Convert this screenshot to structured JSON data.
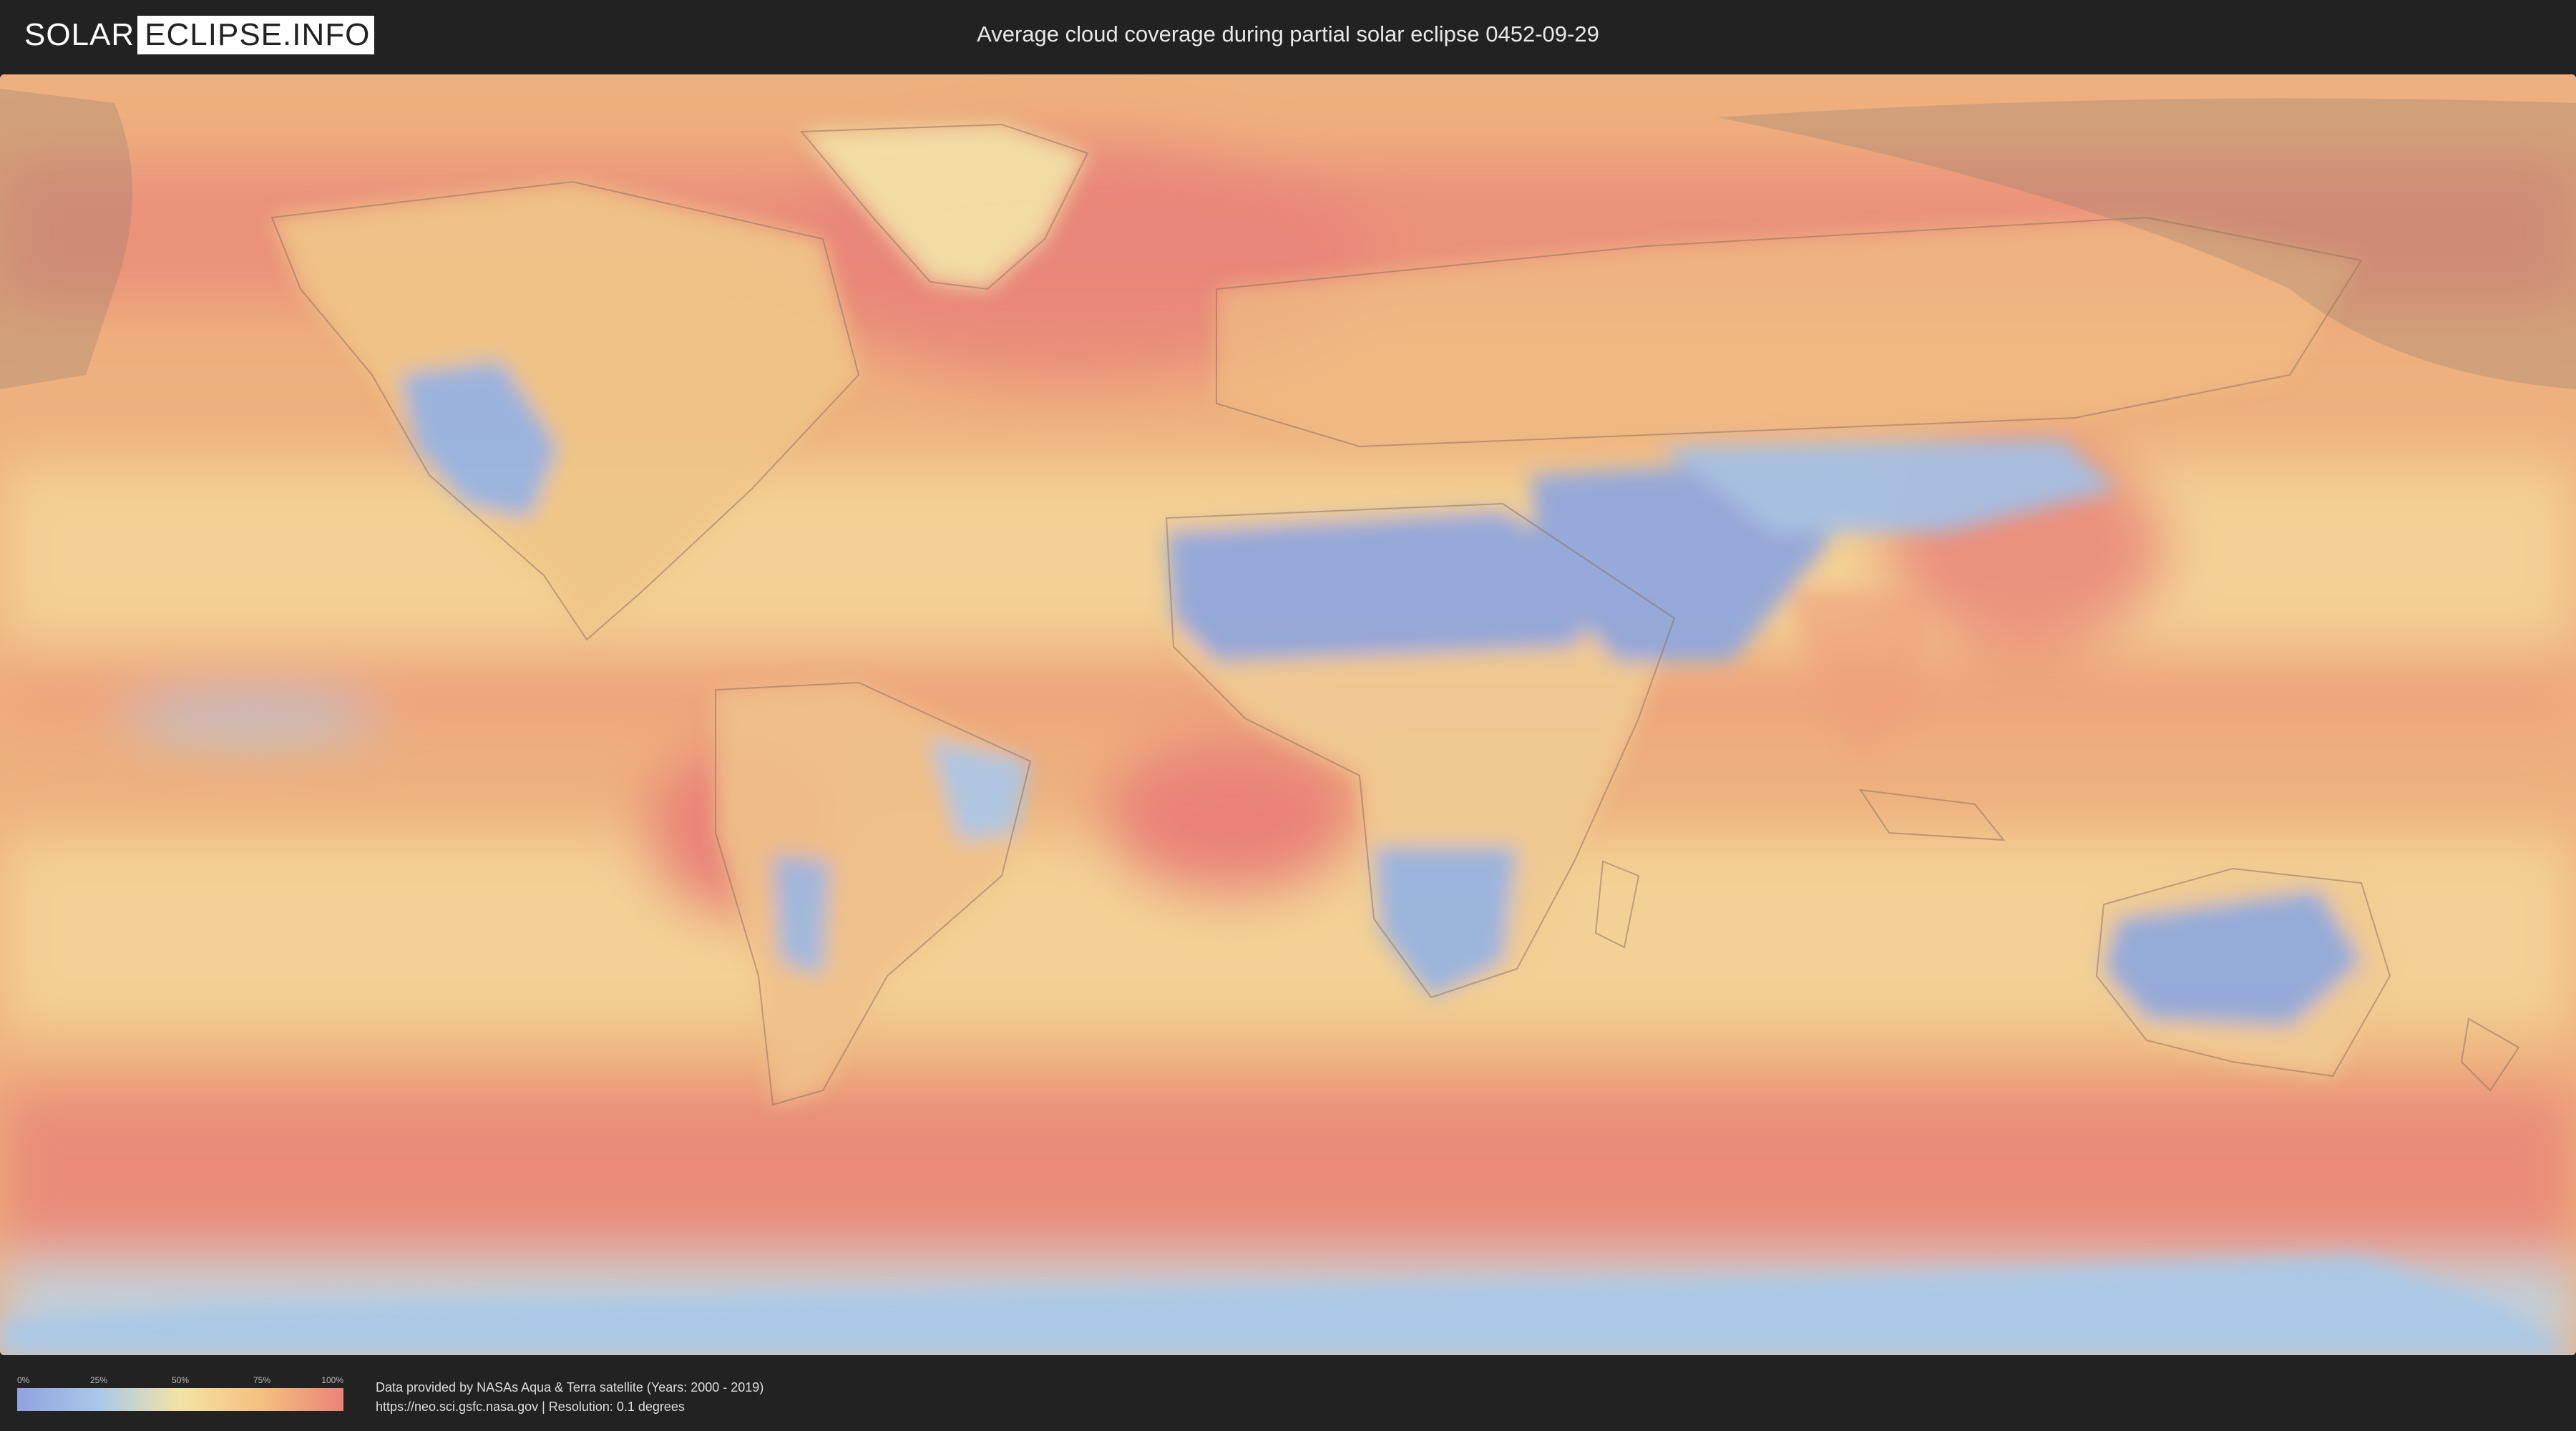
{
  "header": {
    "logo_part1": "SOLAR",
    "logo_part2": "ECLIPSE.INFO",
    "title": "Average cloud coverage during partial solar eclipse 0452-09-29"
  },
  "map": {
    "description_icon": "world-map-icon",
    "colors": {
      "clear": "#8fa3de",
      "low": "#a9c8e8",
      "mid": "#f3e3a5",
      "high": "#f6bf7e",
      "overcast": "#e98379",
      "eclipse_shade": "#8a7a6a"
    }
  },
  "legend": {
    "ticks": [
      "0%",
      "25%",
      "50%",
      "75%",
      "100%"
    ]
  },
  "credits": {
    "line1": "Data provided by NASAs Aqua & Terra satellite (Years: 2000 - 2019)",
    "line2": "https://neo.sci.gsfc.nasa.gov | Resolution: 0.1 degrees"
  }
}
